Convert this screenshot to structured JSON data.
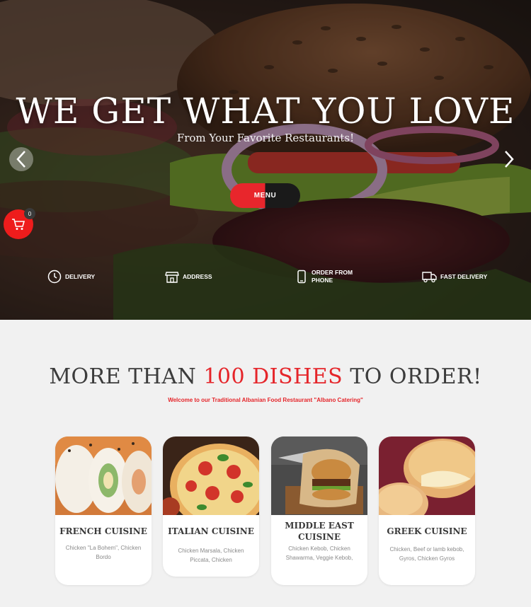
{
  "hero": {
    "title": "WE GET WHAT YOU LOVE",
    "subtitle": "From Your Favorite Restaurants!",
    "menu_button": "MENU",
    "cart_count": "0",
    "features": [
      {
        "label": "DELIVERY",
        "icon": "clock-icon"
      },
      {
        "label": "ADDRESS",
        "icon": "storefront-icon"
      },
      {
        "label": "ORDER FROM PHONE",
        "icon": "phone-icon"
      },
      {
        "label": "FAST DELIVERY",
        "icon": "truck-icon"
      }
    ]
  },
  "section": {
    "title_pre": "MORE THAN ",
    "title_highlight": "100 DISHES",
    "title_post": " TO ORDER!",
    "subtitle": "Welcome to our Traditional Albanian Food Restaurant \"Albano Catering\"",
    "cards": [
      {
        "name": "FRENCH CUISINE",
        "desc": "Chicken \"La Bohem\", Chicken Bordo"
      },
      {
        "name": "ITALIAN CUISINE",
        "desc": "Chicken Marsala, Chicken Piccata, Chicken"
      },
      {
        "name": "MIDDLE EAST CUISINE",
        "desc": "Chicken Kebob, Chicken Shawarma, Veggie Kebob,"
      },
      {
        "name": "GREEK CUISINE",
        "desc": "Chicken, Beef or lamb kebob, Gyros, Chicken Gyros"
      }
    ]
  }
}
